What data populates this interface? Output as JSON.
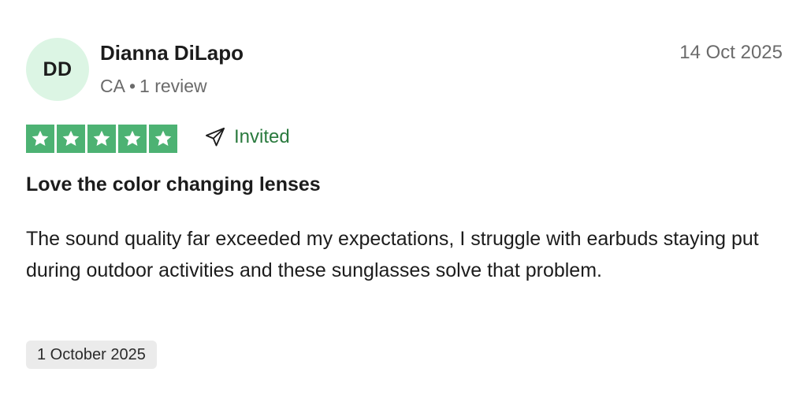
{
  "reviewer": {
    "initials": "DD",
    "name": "Dianna DiLapo",
    "country": "CA",
    "separator": "•",
    "review_count": "1 review",
    "avatar_color": "#dcf5e4"
  },
  "review": {
    "date": "14 Oct 2025",
    "rating": 5,
    "rating_max": 5,
    "star_color": "#4db273",
    "invited_label": "Invited",
    "invited_icon": "send-icon",
    "title": "Love the color changing lenses",
    "body": "The sound quality far exceeded my expectations, I struggle with earbuds staying put during outdoor activities and these sunglasses solve that problem.",
    "experience_date": "1 October 2025"
  },
  "colors": {
    "invited_text": "#2a7a3e",
    "muted_text": "#6b6b6b",
    "badge_bg": "#ebebeb"
  }
}
